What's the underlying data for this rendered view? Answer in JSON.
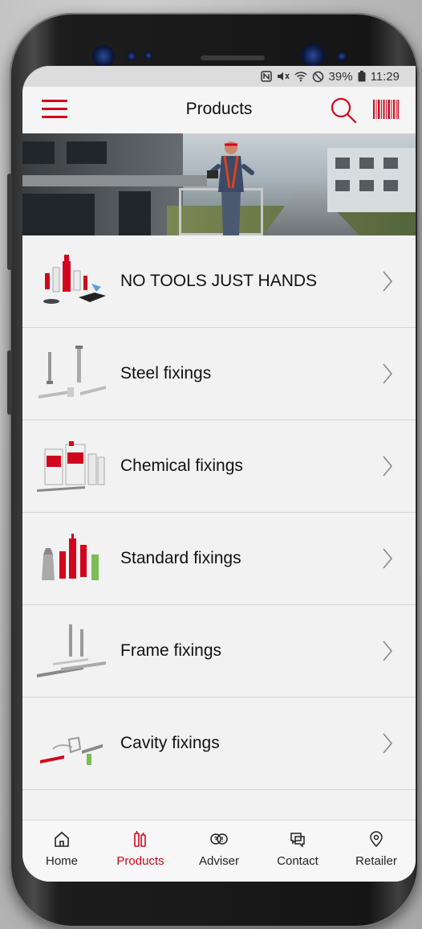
{
  "status_bar": {
    "icons": [
      "nfc-icon",
      "mute-icon",
      "wifi-icon",
      "do-not-disturb-icon"
    ],
    "battery": "39%",
    "time": "11:29"
  },
  "header": {
    "title": "Products",
    "menu_icon": "hamburger-icon",
    "search_icon": "search-icon",
    "scan_icon": "barcode-icon"
  },
  "banner": {
    "description_icon": "hero-image"
  },
  "categories": [
    {
      "label": "NO TOOLS JUST HANDS",
      "icon": "no-tools-products-thumb"
    },
    {
      "label": "Steel fixings",
      "icon": "steel-fixings-thumb"
    },
    {
      "label": "Chemical fixings",
      "icon": "chemical-fixings-thumb"
    },
    {
      "label": "Standard fixings",
      "icon": "standard-fixings-thumb"
    },
    {
      "label": "Frame fixings",
      "icon": "frame-fixings-thumb"
    },
    {
      "label": "Cavity fixings",
      "icon": "cavity-fixings-thumb"
    }
  ],
  "tabs": [
    {
      "label": "Home",
      "icon": "home-icon",
      "active": false
    },
    {
      "label": "Products",
      "icon": "products-icon",
      "active": true
    },
    {
      "label": "Adviser",
      "icon": "adviser-icon",
      "active": false
    },
    {
      "label": "Contact",
      "icon": "contact-icon",
      "active": false
    },
    {
      "label": "Retailer",
      "icon": "location-pin-icon",
      "active": false
    }
  ],
  "colors": {
    "accent": "#d2051e",
    "background": "#f2f2f2",
    "text": "#111111"
  }
}
